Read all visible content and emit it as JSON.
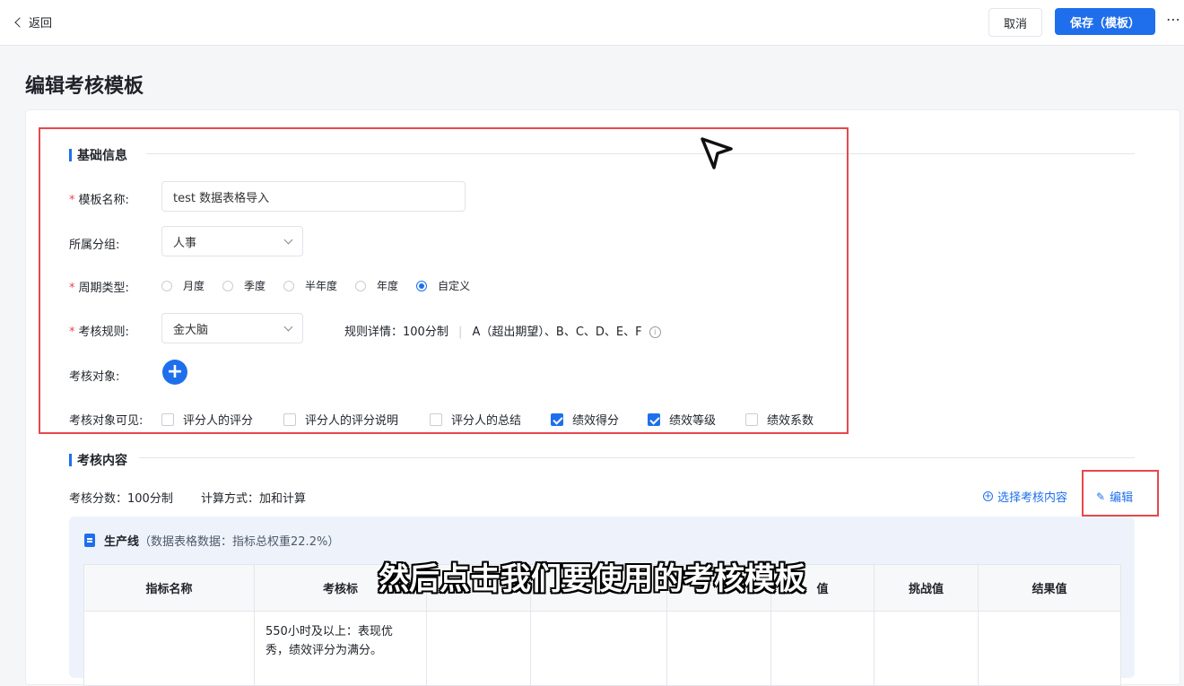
{
  "header": {
    "back_label": "返回",
    "cancel_label": "取消",
    "save_label": "保存（模板）",
    "more_label": "⋯"
  },
  "page": {
    "title": "编辑考核模板"
  },
  "basic_info": {
    "section_title": "基础信息",
    "template_name": {
      "label": "模板名称:",
      "value": "test 数据表格导入"
    },
    "group": {
      "label": "所属分组:",
      "value": "人事"
    },
    "cycle_type": {
      "label": "周期类型:",
      "options": [
        "月度",
        "季度",
        "半年度",
        "年度",
        "自定义"
      ],
      "selected": "自定义"
    },
    "rule": {
      "label": "考核规则:",
      "value": "金大脑",
      "detail_label": "规则详情：",
      "detail_score": "100分制",
      "detail_grades": "A（超出期望）、B、C、D、E、F"
    },
    "target": {
      "label": "考核对象:"
    },
    "visible": {
      "label": "考核对象可见:",
      "options": [
        {
          "label": "评分人的评分",
          "checked": false
        },
        {
          "label": "评分人的评分说明",
          "checked": false
        },
        {
          "label": "评分人的总结",
          "checked": false
        },
        {
          "label": "绩效得分",
          "checked": true
        },
        {
          "label": "绩效等级",
          "checked": true
        },
        {
          "label": "绩效系数",
          "checked": false
        }
      ]
    }
  },
  "content": {
    "section_title": "考核内容",
    "score_label": "考核分数：100分制",
    "calc_label": "计算方式：加和计算",
    "select_link": "选择考核内容",
    "edit_link": "编辑",
    "group": {
      "name": "生产线",
      "meta": "（数据表格数据：指标总权重22.2%）"
    },
    "table": {
      "columns": [
        "指标名称",
        "考核标",
        "",
        "",
        "",
        "值",
        "挑战值",
        "结果值"
      ],
      "rows": [
        [
          "",
          "550小时及以上：表现优秀，绩效评分为满分。",
          "",
          "",
          "",
          "",
          "",
          ""
        ]
      ]
    }
  },
  "subtitle": "然后点击我们要使用的考核模板"
}
